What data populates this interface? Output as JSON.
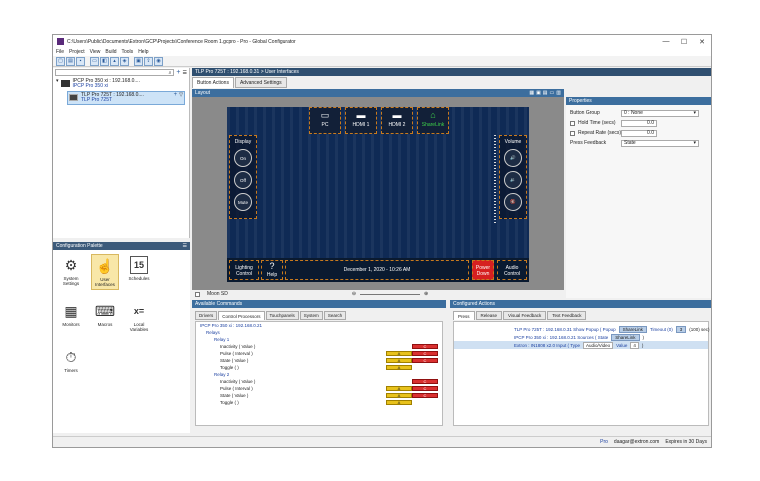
{
  "window": {
    "title": "C:\\Users\\Public\\Documents\\Extron\\GCP\\Projects\\Conference Room 1.gcpro - Pro - Global Configurator",
    "min": "—",
    "max": "☐",
    "close": "✕"
  },
  "menu": [
    "File",
    "Project",
    "View",
    "Build",
    "Tools",
    "Help"
  ],
  "tree": {
    "item1_line1": "IPCP Pro 350 xi : 192.168.0....",
    "item1_line2": "IPCP Pro 350 xi",
    "item2_line1": "TLP Pro 725T : 192.168.0....",
    "item2_line2": "TLP Pro 725T"
  },
  "palette": {
    "header": "Configuration Palette",
    "items": [
      {
        "label": "System Settings",
        "icon": "⚙"
      },
      {
        "label": "User Interfaces",
        "icon": "☝"
      },
      {
        "label": "Schedules",
        "icon": "15"
      },
      {
        "label": "Monitors",
        "icon": "▦"
      },
      {
        "label": "Macros",
        "icon": "⌨"
      },
      {
        "label": "Local Variables",
        "icon": "x="
      },
      {
        "label": "Timers",
        "icon": "⏱"
      }
    ]
  },
  "breadcrumb": "TLP Pro 725T : 192.168.0.31  >  User Interfaces",
  "tabs": {
    "button_actions": "Button Actions",
    "advanced": "Advanced Settings"
  },
  "layout": {
    "header": "Layout",
    "sources": [
      {
        "label": "PC",
        "icon": "▭"
      },
      {
        "label": "HDMI 1",
        "icon": "▬"
      },
      {
        "label": "HDMI 2",
        "icon": "▬"
      },
      {
        "label": "ShareLink",
        "icon": "⌂"
      }
    ],
    "display_label": "Display",
    "display_buttons": [
      "On",
      "Off",
      "Mute"
    ],
    "volume_label": "Volume",
    "volume_buttons": [
      "🔊",
      "🔉",
      "🔇"
    ],
    "lighting": "Lighting Control",
    "help_q": "?",
    "help": "Help",
    "datetime": "December 1, 2020 - 10:26 AM",
    "power": "Power Down",
    "audio": "Audio Control",
    "moon": "Moon SD"
  },
  "properties": {
    "header": "Properties",
    "button_group_label": "Button Group",
    "button_group_value": "0 : None",
    "hold_time_label": "Hold Time (secs)",
    "hold_time_value": "0.0",
    "repeat_rate_label": "Repeat Rate (secs)",
    "repeat_rate_value": "0.0",
    "press_feedback_label": "Press Feedback",
    "press_feedback_value": "State"
  },
  "commands": {
    "header": "Available Commands",
    "tabs": [
      "Drivers",
      "Control Processors",
      "Touchpanels",
      "System",
      "Search"
    ],
    "device": "IPCP Pro 350 xi : 192.168.0.21",
    "relays": "Relays",
    "relay1": "Relay 1",
    "relay2": "Relay 2",
    "cmds": [
      "Inactivity ( Value )",
      "Pulse ( Interval )",
      "State ( Value )",
      "Toggle ( )"
    ],
    "a": "A",
    "c": "C"
  },
  "actions": {
    "header": "Configured Actions",
    "tabs": [
      "Press",
      "Release",
      "Visual Feedback",
      "Text Feedback"
    ],
    "row1": "TLP Pro 725T : 192.168.0.31  Show Popup ( Popup",
    "row1_chip": "ShareLink",
    "row1_b": "Timeout (0)",
    "row1_c": "3",
    "row1_d": "(100) sec)",
    "row2": "IPCP Pro 350 xi : 192.168.0.21  Sources ( State",
    "row2_chip": "ShareLink",
    "row2_b": ")",
    "row3a": "Extron : IN1808 x2.0  Input ( Type",
    "row3b": "Audio/Video",
    "row3c": "Value",
    "row3d": "4",
    "row3e": ")"
  },
  "status": {
    "mode": "Pro",
    "user": "daagar@extron.com",
    "expires": "Expires in 30 Days"
  }
}
